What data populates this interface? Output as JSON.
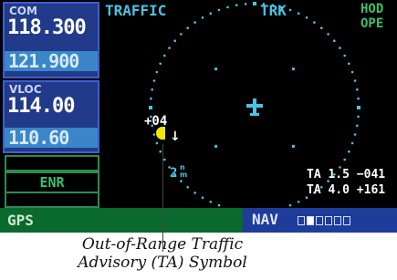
{
  "com": {
    "label": "COM",
    "active": "118.300",
    "standby": "121.900"
  },
  "vloc": {
    "label": "VLOC",
    "active": "114.00",
    "standby": "110.60"
  },
  "mode_box": {
    "label": "ENR"
  },
  "status_bar": {
    "gps": "GPS",
    "nav": "NAV",
    "page_count": 6,
    "active_page": 2
  },
  "radar": {
    "title": "TRAFFIC",
    "orientation": "TRK",
    "mode_line1": "HOD",
    "mode_line2": "OPE",
    "intruder_altitude": "+04",
    "intruder_trend": "↓",
    "range_value": "2",
    "range_unit_top": "n",
    "range_unit_bottom": "m",
    "ta_line1": "TA 1.5 −041",
    "ta_line2": "TA 4.0 +161"
  },
  "colors": {
    "cyan": "#49c3e6",
    "green": "#3ac06a",
    "ta_symbol": "#f2e600"
  },
  "icons": {
    "ownship": "aircraft-icon",
    "traffic": "traffic-advisory-icon"
  },
  "caption": {
    "line1": "Out-of-Range Traffic",
    "line2": "Advisory (TA) Symbol"
  }
}
